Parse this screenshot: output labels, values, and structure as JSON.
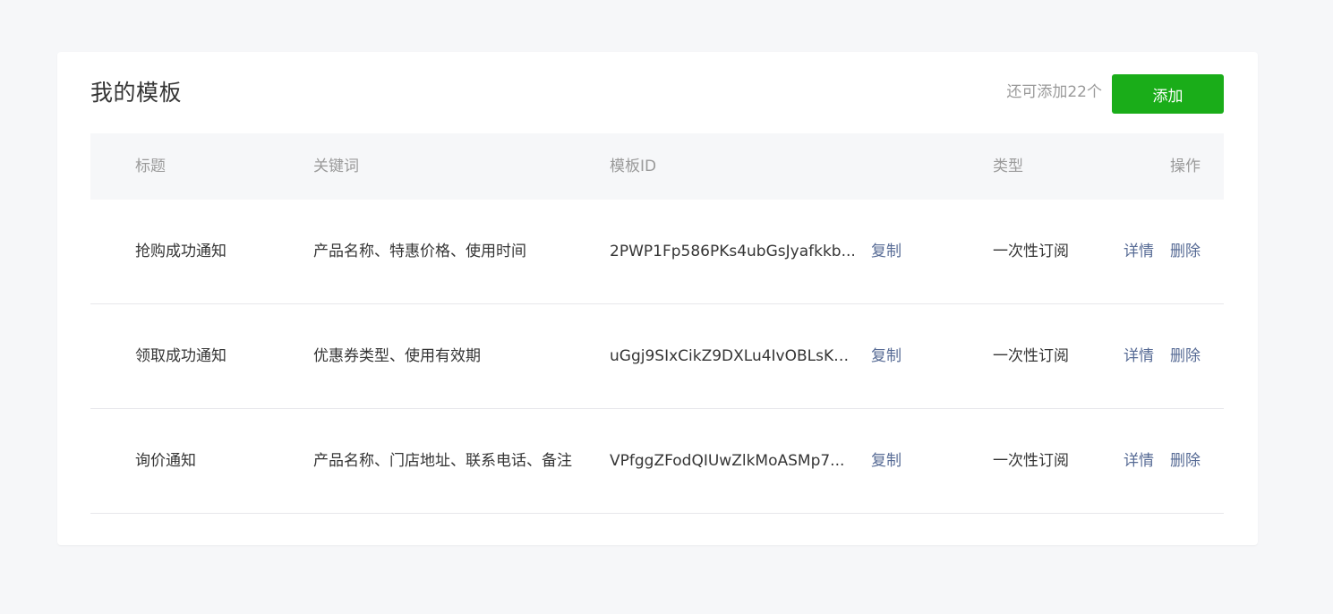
{
  "header": {
    "title": "我的模板",
    "remaining": "还可添加22个",
    "add_label": "添加"
  },
  "table": {
    "columns": {
      "title": "标题",
      "keywords": "关键词",
      "template_id": "模板ID",
      "type": "类型",
      "actions": "操作"
    },
    "rows": [
      {
        "title": "抢购成功通知",
        "keywords": "产品名称、特惠价格、使用时间",
        "template_id": "2PWP1Fp586PKs4ubGsJyafkkb...",
        "copy": "复制",
        "type": "一次性订阅",
        "detail": "详情",
        "delete": "删除"
      },
      {
        "title": "领取成功通知",
        "keywords": "优惠券类型、使用有效期",
        "template_id": "uGgj9SIxCikZ9DXLu4IvOBLsKw...",
        "copy": "复制",
        "type": "一次性订阅",
        "detail": "详情",
        "delete": "删除"
      },
      {
        "title": "询价通知",
        "keywords": "产品名称、门店地址、联系电话、备注",
        "template_id": "VPfggZFodQIUwZlkMoASMp7...",
        "copy": "复制",
        "type": "一次性订阅",
        "detail": "详情",
        "delete": "删除"
      }
    ]
  },
  "colors": {
    "background": "#f6f7f9",
    "primary_button": "#1aad19",
    "link": "#576b95",
    "text": "#353535",
    "muted": "#9a9a9a"
  }
}
